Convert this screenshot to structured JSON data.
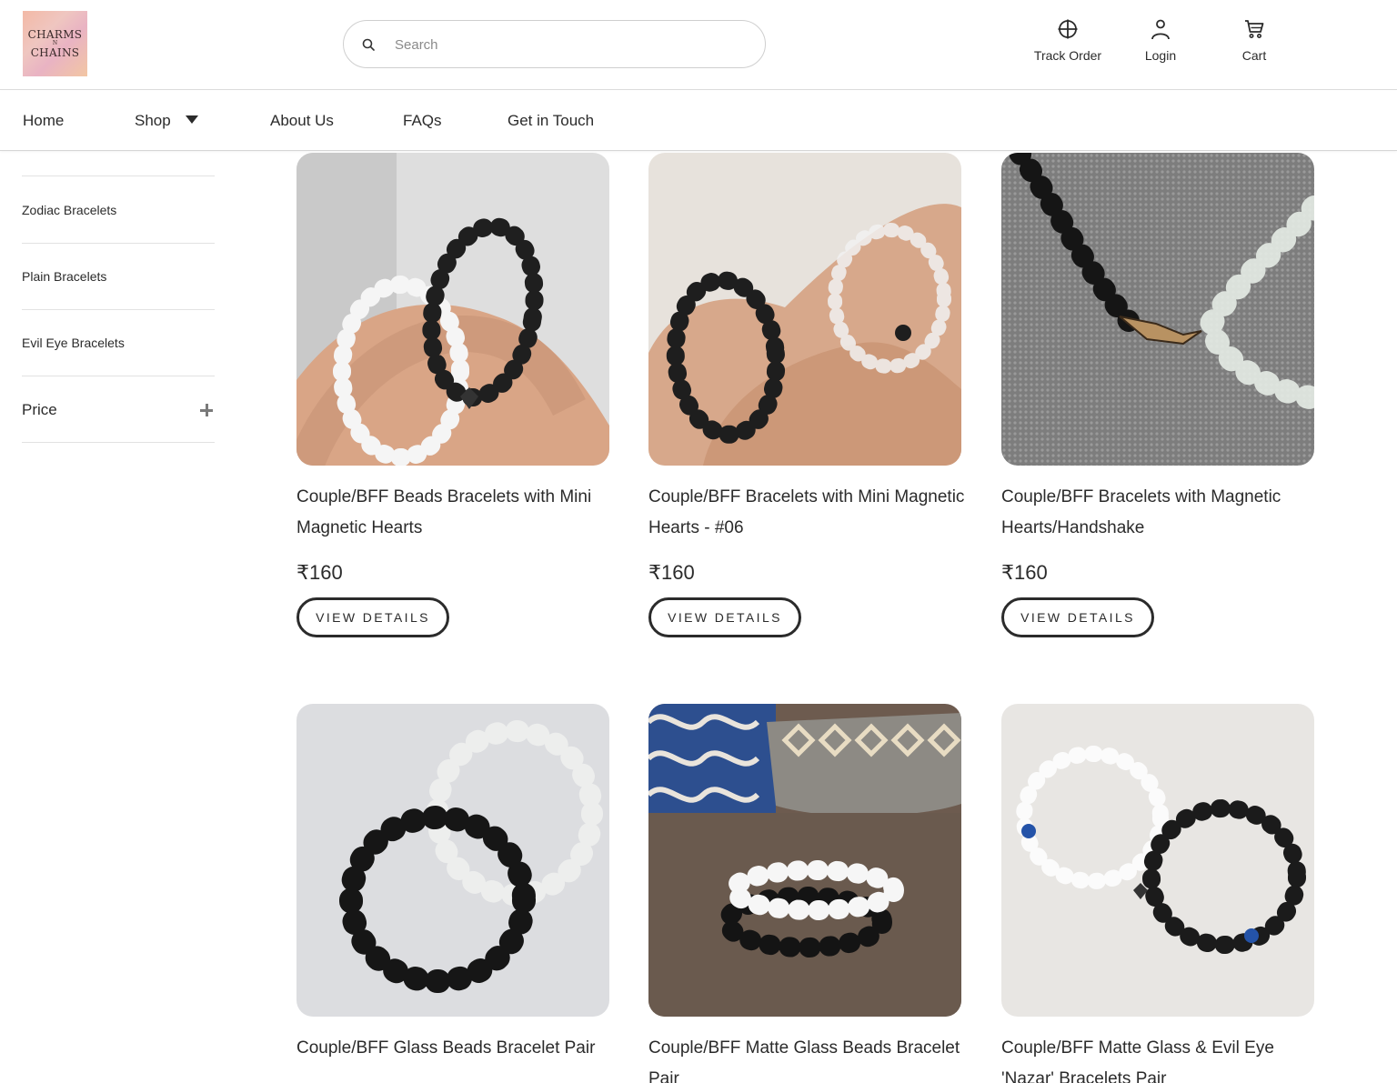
{
  "logo": {
    "line1": "CHARMS",
    "line2": "N",
    "line3": "CHAINS"
  },
  "search": {
    "placeholder": "Search"
  },
  "header_actions": {
    "track_order": "Track Order",
    "login": "Login",
    "cart": "Cart"
  },
  "nav": {
    "home": "Home",
    "shop": "Shop",
    "about": "About Us",
    "faqs": "FAQs",
    "contact": "Get in Touch"
  },
  "sidebar": {
    "items": [
      "Zodiac Bracelets",
      "Plain Bracelets",
      "Evil Eye Bracelets"
    ],
    "price_label": "Price"
  },
  "products": [
    {
      "title": "Couple/BFF Beads Bracelets with Mini Magnetic Hearts",
      "price": "₹160",
      "button": "VIEW DETAILS"
    },
    {
      "title": "Couple/BFF Bracelets with Mini Magnetic Hearts - #06",
      "price": "₹160",
      "button": "VIEW DETAILS"
    },
    {
      "title": "Couple/BFF Bracelets with Magnetic Hearts/Handshake",
      "price": "₹160",
      "button": "VIEW DETAILS"
    },
    {
      "title": "Couple/BFF Glass Beads Bracelet Pair"
    },
    {
      "title": "Couple/BFF Matte Glass Beads Bracelet Pair"
    },
    {
      "title": "Couple/BFF Matte Glass & Evil Eye 'Nazar' Bracelets Pair"
    }
  ],
  "icons": {
    "search": "search-icon",
    "track": "crosshair-icon",
    "login": "user-icon",
    "cart": "cart-icon",
    "shop_caret": "caret-down-icon",
    "price_toggle": "plus-icon"
  }
}
